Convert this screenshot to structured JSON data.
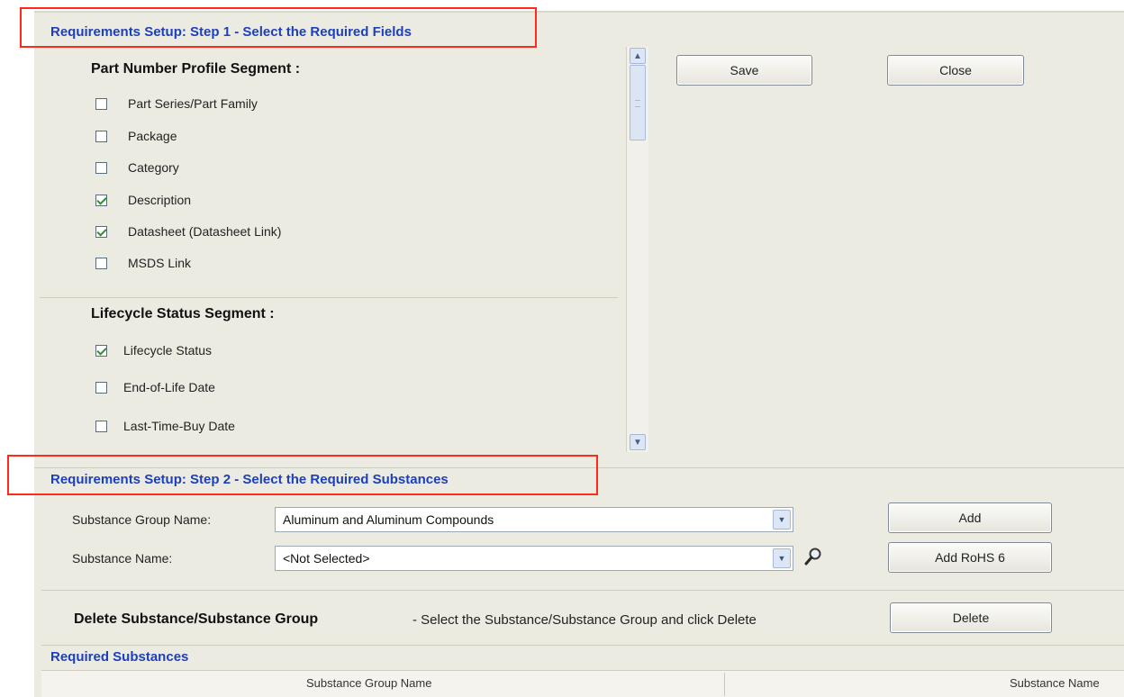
{
  "step1": {
    "title": "Requirements Setup: Step 1 - Select the Required Fields",
    "part_segment": {
      "title": "Part Number Profile Segment :",
      "fields": [
        {
          "label": "Part Series/Part Family",
          "checked": false
        },
        {
          "label": "Package",
          "checked": false
        },
        {
          "label": "Category",
          "checked": false
        },
        {
          "label": "Description",
          "checked": true
        },
        {
          "label": "Datasheet (Datasheet Link)",
          "checked": true
        },
        {
          "label": "MSDS Link",
          "checked": false
        }
      ]
    },
    "lifecycle_segment": {
      "title": "Lifecycle Status Segment :",
      "fields": [
        {
          "label": "Lifecycle Status",
          "checked": true
        },
        {
          "label": "End-of-Life Date",
          "checked": false
        },
        {
          "label": "Last-Time-Buy Date",
          "checked": false
        }
      ]
    }
  },
  "buttons": {
    "save": "Save",
    "close": "Close",
    "add": "Add",
    "add_rohs": "Add RoHS 6",
    "delete": "Delete"
  },
  "step2": {
    "title": "Requirements Setup: Step 2 - Select the Required Substances",
    "group_label": "Substance Group Name:",
    "group_value": "Aluminum and Aluminum Compounds",
    "substance_label": "Substance Name:",
    "substance_value": "<Not Selected>"
  },
  "delete_section": {
    "title": "Delete Substance/Substance Group",
    "hint": "- Select the Substance/Substance Group and click Delete"
  },
  "required_substances": {
    "title": "Required Substances",
    "columns": [
      "Substance Group Name",
      "Substance Name"
    ]
  },
  "colors": {
    "panel_bg": "#ecebe2",
    "step_title": "#1c3fbd",
    "highlight_box": "#ff2a1a",
    "checkmark": "#2f8f2f"
  },
  "icons": {
    "scroll_up": "chevron-up-icon",
    "scroll_down": "chevron-down-icon",
    "combo_dropdown": "chevron-down-icon",
    "search": "magnifier-icon"
  }
}
